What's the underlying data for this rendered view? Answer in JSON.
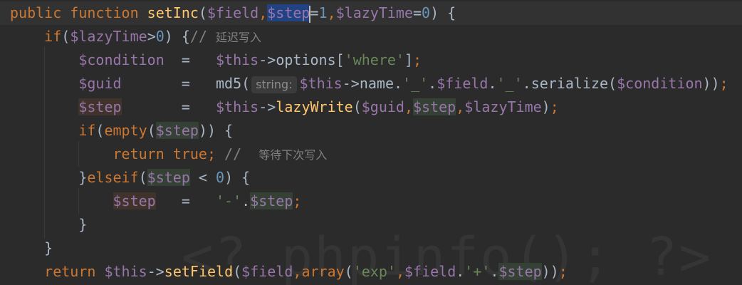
{
  "watermark": "<? phpinfo(); ?>",
  "code": {
    "l1": {
      "kw_public": "public",
      "kw_function": "function",
      "fn_name": "setInc",
      "p_open": "(",
      "v_field": "$field",
      "comma1": ",",
      "v_step": "$step",
      "eq1": "=",
      "n_1": "1",
      "comma2": ",",
      "v_lazy": "$lazyTime",
      "eq2": "=",
      "n_0": "0",
      "p_close": ") {"
    },
    "l2": {
      "kw_if": "if",
      "p_open": "(",
      "v_lazy": "$lazyTime",
      "gt": ">",
      "n_0": "0",
      "p_close": ") {",
      "cm_slash": "// ",
      "cm_text": "延迟写入"
    },
    "l3": {
      "v_condition": "$condition",
      "eq": "=",
      "v_this": "$this",
      "arrow": "->",
      "prop": "options",
      "br_open": "[",
      "s_where": "'where'",
      "br_close": "]",
      "semi": ";"
    },
    "l4": {
      "v_guid": "$guid",
      "eq": "=",
      "fn_md5": "md5(",
      "hint": "string:",
      "v_this": "$this",
      "arrow": "->",
      "prop": "name",
      "dot1": ".",
      "s_us1": "'_'",
      "dot2": ".",
      "v_field": "$field",
      "dot3": ".",
      "s_us2": "'_'",
      "dot4": ".",
      "fn_serialize": "serialize(",
      "v_condition": "$condition",
      "p_close": "))",
      "semi": ";"
    },
    "l5": {
      "v_step": "$step",
      "eq": "=",
      "v_this": "$this",
      "arrow": "->",
      "fn_lazy": "lazyWrite",
      "p_open": "(",
      "v_guid": "$guid",
      "comma1": ",",
      "comma2": ",",
      "v_lazy": "$lazyTime",
      "p_close": ")",
      "semi": ";"
    },
    "l6": {
      "kw_if": "if",
      "p_open": "(",
      "kw_empty": "empty",
      "p_open2": "(",
      "v_step": "$step",
      "p_close": ")) {"
    },
    "l7": {
      "kw_return": "return",
      "kw_true": "true",
      "semi": ";",
      "cm_slash": " // ",
      "cm_text": "等待下次写入"
    },
    "l8": {
      "brace": "}",
      "kw_elseif": "elseif",
      "p_open": "(",
      "v_step": "$step",
      "lt": " < ",
      "n_0": "0",
      "p_close": ") {"
    },
    "l9": {
      "v_step": "$step",
      "eq": "=",
      "s_minus": "'-'",
      "dot": ".",
      "v_step2": "$step",
      "semi": ";"
    },
    "l10": {
      "brace": "}"
    },
    "l11": {
      "brace": "}"
    },
    "l12": {
      "kw_return": "return",
      "v_this": "$this",
      "arrow": "->",
      "fn_setfield": "setField",
      "p_open": "(",
      "v_field": "$field",
      "comma1": ",",
      "kw_array": "array",
      "p_open2": "(",
      "s_exp": "'exp'",
      "comma2": ",",
      "v_field2": "$field",
      "dot1": ".",
      "s_plus": "'+'",
      "dot2": ".",
      "v_step": "$step",
      "p_close": "))",
      "semi": ";"
    }
  }
}
